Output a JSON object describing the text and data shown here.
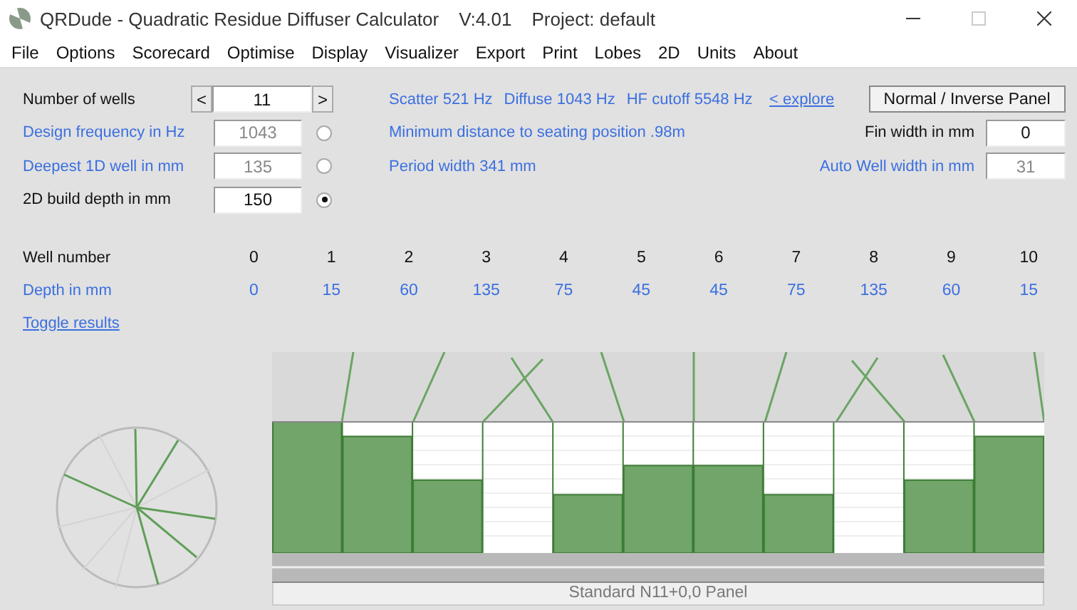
{
  "window": {
    "title": "QRDude - Quadratic Residue Diffuser Calculator",
    "version": "V:4.01",
    "project": "Project: default"
  },
  "window_controls": [
    {
      "kind": "minimize",
      "disabled": false
    },
    {
      "kind": "maximize",
      "disabled": true
    },
    {
      "kind": "close",
      "disabled": false
    }
  ],
  "menu": [
    "File",
    "Options",
    "Scorecard",
    "Optimise",
    "Display",
    "Visualizer",
    "Export",
    "Print",
    "Lobes",
    "2D",
    "Units",
    "About"
  ],
  "wells_control": {
    "label": "Number of wells",
    "value": "11",
    "decrement": "<",
    "increment": ">"
  },
  "parameters": [
    {
      "label": "Design frequency in Hz",
      "value": "1043",
      "selected": false
    },
    {
      "label": "Deepest 1D well in mm",
      "value": "135",
      "selected": false
    },
    {
      "label": "2D build depth in mm",
      "value": "150",
      "selected": true
    }
  ],
  "results": [
    "Scatter 521 Hz",
    "Diffuse 1043 Hz",
    "HF cutoff 5548 Hz"
  ],
  "explore_link": "< explore",
  "min_distance": "Minimum distance to seating position  .98m",
  "period_width": "Period width  341 mm",
  "panel_button": "Normal / Inverse Panel",
  "fin_width": {
    "label": "Fin width in mm",
    "value": "0",
    "editable": true
  },
  "auto_well_width": {
    "label": "Auto Well width in mm",
    "value": "31",
    "editable": false
  },
  "well_table": {
    "number_label": "Well number",
    "depth_label": "Depth in mm",
    "wells": [
      {
        "number": "0",
        "depth": "0"
      },
      {
        "number": "1",
        "depth": "15"
      },
      {
        "number": "2",
        "depth": "60"
      },
      {
        "number": "3",
        "depth": "135"
      },
      {
        "number": "4",
        "depth": "75"
      },
      {
        "number": "5",
        "depth": "45"
      },
      {
        "number": "6",
        "depth": "45"
      },
      {
        "number": "7",
        "depth": "75"
      },
      {
        "number": "8",
        "depth": "135"
      },
      {
        "number": "9",
        "depth": "60"
      },
      {
        "number": "10",
        "depth": "15"
      }
    ]
  },
  "toggle_link": "Toggle results",
  "panel_caption": "Standard N11+0,0 Panel"
}
